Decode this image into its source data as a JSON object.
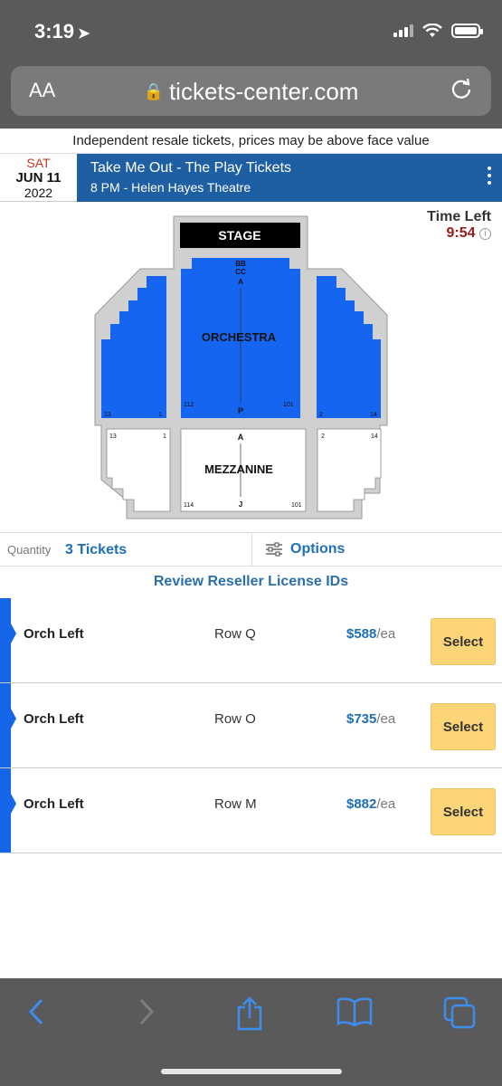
{
  "status_bar": {
    "time": "3:19"
  },
  "browser": {
    "aa_label": "AA",
    "url": "tickets-center.com"
  },
  "disclaimer": "Independent resale tickets, prices may be above face value",
  "event": {
    "day_of_week": "SAT",
    "month_day": "JUN 11",
    "year": "2022",
    "title": "Take Me Out - The Play Tickets",
    "subtitle": "8 PM - Helen Hayes Theatre"
  },
  "timer": {
    "label": "Time Left",
    "value": "9:54",
    "info_glyph": "i"
  },
  "seatmap": {
    "stage": "STAGE",
    "orchestra": "ORCHESTRA",
    "mezzanine": "MEZZANINE",
    "orch_rows_top": [
      "BB",
      "CC",
      "A"
    ],
    "orch_row_bottom": "P",
    "orch_left_low": "13",
    "orch_left_high": "1",
    "orch_center_left": "112",
    "orch_center_right": "101",
    "orch_right_low": "2",
    "orch_right_high": "14",
    "mezz_row_top": "A",
    "mezz_row_bottom": "J",
    "mezz_left_low": "13",
    "mezz_left_high": "1",
    "mezz_center_left": "114",
    "mezz_center_right": "101",
    "mezz_right_low": "2",
    "mezz_right_high": "14",
    "colors": {
      "available": "#1565f0",
      "unavailable": "#ffffff",
      "frame": "#cfcfcf",
      "stage": "#000000"
    }
  },
  "filters": {
    "quantity_label": "Quantity",
    "quantity_value": "3 Tickets",
    "options_label": "Options"
  },
  "review_link": "Review Reseller License IDs",
  "listings": [
    {
      "section": "Orch Left",
      "row": "Row Q",
      "price": "$588",
      "unit": "/ea",
      "button": "Select"
    },
    {
      "section": "Orch Left",
      "row": "Row O",
      "price": "$735",
      "unit": "/ea",
      "button": "Select"
    },
    {
      "section": "Orch Left",
      "row": "Row M",
      "price": "$882",
      "unit": "/ea",
      "button": "Select"
    }
  ],
  "toolbar": {
    "back_icon": "chevron-left-icon",
    "forward_icon": "chevron-right-icon",
    "share_icon": "share-icon",
    "bookmarks_icon": "book-icon",
    "tabs_icon": "tabs-icon"
  }
}
